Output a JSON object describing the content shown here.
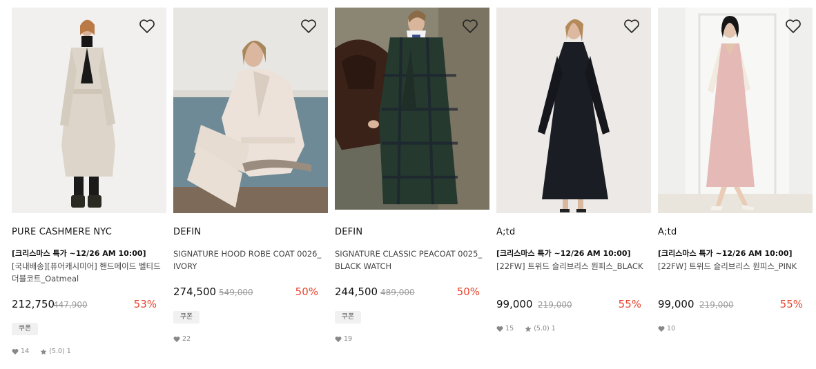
{
  "products": [
    {
      "brand": "PURE CASHMERE NYC",
      "promo": "[크리스마스 특가 ~12/26 AM 10:00]",
      "name": "[국내배송][퓨어캐시미어] 핸드메이드 벨티드 더블코트_Oatmeal",
      "price": "212,750",
      "original_price": "447,900",
      "discount": "53%",
      "coupon": "쿠폰",
      "likes": "14",
      "rating": "(5.0)",
      "reviews": "1",
      "image": "model-oatmeal-double-coat"
    },
    {
      "brand": "DEFIN",
      "promo": "",
      "name": "SIGNATURE HOOD ROBE COAT 0026_IVORY",
      "price": "274,500",
      "original_price": "549,000",
      "discount": "50%",
      "coupon": "쿠폰",
      "likes": "22",
      "image": "model-ivory-hood-robe-coat"
    },
    {
      "brand": "DEFIN",
      "promo": "",
      "name": "SIGNATURE CLASSIC PEACOAT 0025_BLACK WATCH",
      "price": "244,500",
      "original_price": "489,000",
      "discount": "50%",
      "coupon": "쿠폰",
      "likes": "19",
      "image": "model-black-watch-peacoat-with-horse"
    },
    {
      "brand": "A;td",
      "promo": "[크리스마스 특가 ~12/26 AM 10:00]",
      "name": "[22FW] 트위드 슬리브리스 원피스_BLACK",
      "price": "99,000",
      "original_price": "219,000",
      "discount": "55%",
      "likes": "15",
      "rating": "(5.0)",
      "reviews": "1",
      "image": "model-black-tweed-dress"
    },
    {
      "brand": "A;td",
      "promo": "[크리스마스 특가 ~12/26 AM 10:00]",
      "name": "[22FW] 트위드 슬리브리스 원피스_PINK",
      "price": "99,000",
      "original_price": "219,000",
      "discount": "55%",
      "likes": "10",
      "image": "model-pink-tweed-dress"
    }
  ],
  "colors": {
    "discount": "#e8442e",
    "text": "#222222",
    "muted": "#888888",
    "coupon_bg": "#f1f1f1"
  },
  "icons": {
    "wishlist": "heart-outline-icon",
    "likes": "heart-filled-icon",
    "rating": "star-icon"
  }
}
